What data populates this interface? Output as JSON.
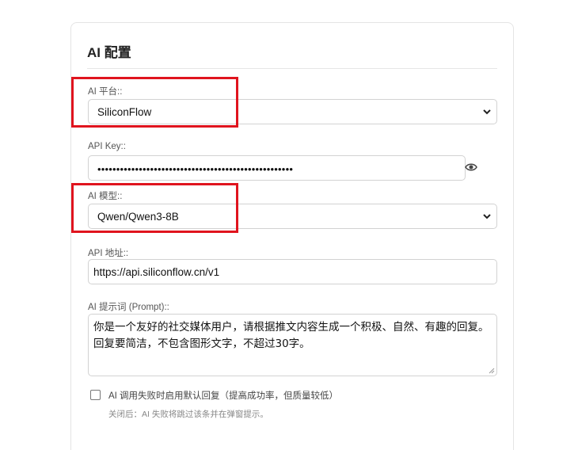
{
  "section": {
    "title": "AI 配置"
  },
  "platform": {
    "label": "AI 平台::",
    "value": "SiliconFlow"
  },
  "api_key": {
    "label": "API Key::",
    "masked_value": "••••••••••••••••••••••••••••••••••••••••••••••••••••",
    "toggle_icon": "eye-icon"
  },
  "model": {
    "label": "AI 模型::",
    "value": "Qwen/Qwen3-8B"
  },
  "api_url": {
    "label": "API 地址::",
    "value": "https://api.siliconflow.cn/v1"
  },
  "prompt": {
    "label": "AI 提示词 (Prompt)::",
    "value": "你是一个友好的社交媒体用户，请根据推文内容生成一个积极、自然、有趣的回复。回复要简洁，不包含图形文字，不超过30字。"
  },
  "fallback": {
    "label": "AI 调用失败时启用默认回复（提高成功率，但质量较低）",
    "checked": false,
    "hint": "关闭后：AI 失败将跳过该条并在弹窗提示。"
  },
  "colors": {
    "highlight": "#e0141e",
    "border": "#d2d2d2"
  }
}
